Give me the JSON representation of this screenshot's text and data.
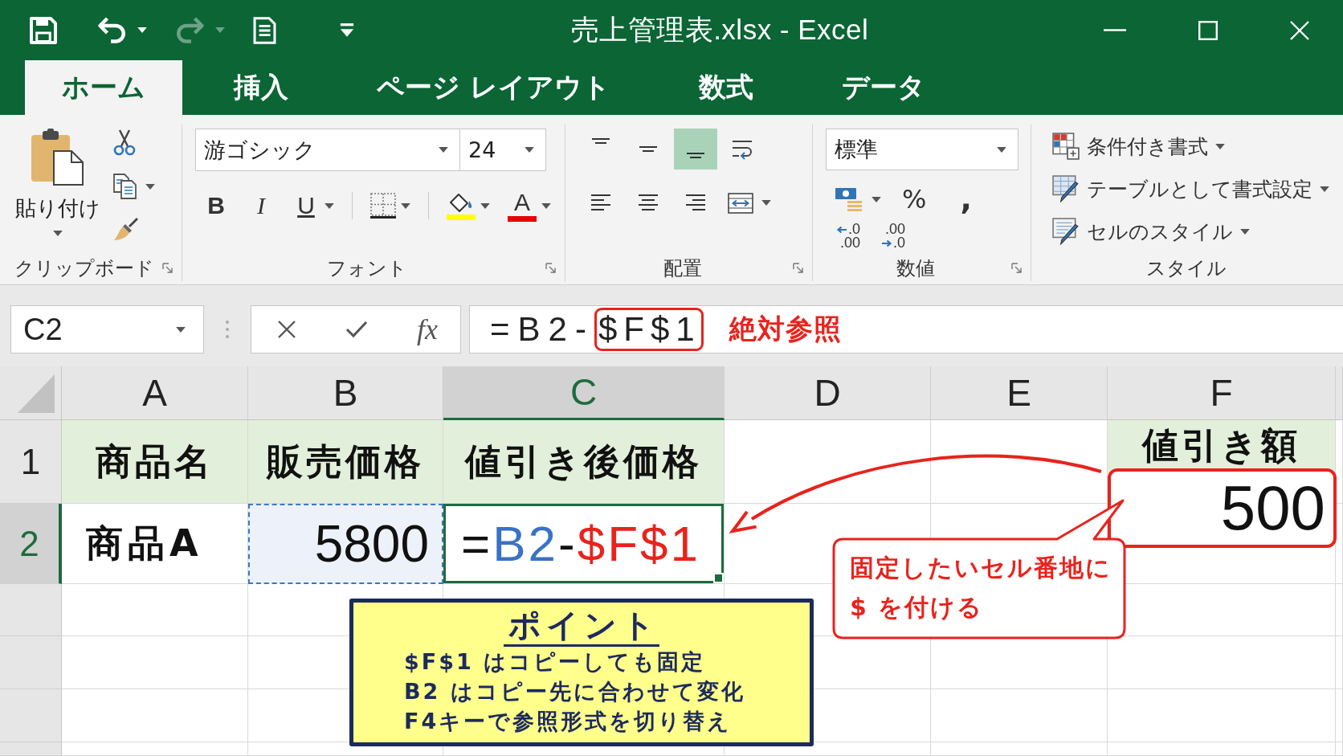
{
  "title_bar": {
    "quick_access": [
      {
        "kind": "save",
        "disabled": false,
        "dropdown": false
      },
      {
        "kind": "undo",
        "disabled": false,
        "dropdown": true
      },
      {
        "kind": "redo",
        "disabled": true,
        "dropdown": true
      },
      {
        "kind": "form",
        "disabled": false,
        "dropdown": false
      },
      {
        "kind": "customize",
        "disabled": false,
        "dropdown": false
      }
    ],
    "title": "売上管理表.xlsx - Excel",
    "window_controls": [
      {
        "kind": "minimize"
      },
      {
        "kind": "maximize"
      },
      {
        "kind": "close"
      }
    ]
  },
  "tabs": [
    {
      "label": "ホーム",
      "selected": true
    },
    {
      "label": "挿入",
      "selected": false
    },
    {
      "label": "ページ レイアウト",
      "selected": false
    },
    {
      "label": "数式",
      "selected": false
    },
    {
      "label": "データ",
      "selected": false
    }
  ],
  "ribbon": [
    {
      "kind": "clipboard",
      "label": "クリップボード",
      "launcher": true,
      "paste": {
        "label": "貼り付け",
        "dropdown": true
      },
      "tools": [
        {
          "kind": "cut",
          "dropdown": false
        },
        {
          "kind": "copy",
          "dropdown": true
        },
        {
          "kind": "format_painter",
          "dropdown": false
        }
      ]
    },
    {
      "kind": "font",
      "label": "フォント",
      "launcher": true,
      "font_name": "游ゴシック",
      "font_size": "24",
      "buttons": [
        {
          "kind": "bold",
          "label": "B",
          "dropdown": false
        },
        {
          "kind": "italic",
          "label": "I",
          "dropdown": false
        },
        {
          "kind": "underline",
          "label": "U",
          "dropdown": true
        },
        {
          "kind": "separator"
        },
        {
          "kind": "borders",
          "dropdown": true
        },
        {
          "kind": "separator"
        },
        {
          "kind": "fill_color",
          "color": "#ffff00",
          "dropdown": true
        },
        {
          "kind": "font_color",
          "label": "A",
          "color": "#e50000",
          "dropdown": true
        }
      ]
    },
    {
      "kind": "alignment",
      "label": "配置",
      "launcher": true,
      "button_rows": [
        [
          {
            "kind": "align_top",
            "selected": false,
            "dropdown": false
          },
          {
            "kind": "align_middle",
            "selected": false,
            "dropdown": false
          },
          {
            "kind": "align_bottom",
            "selected": true,
            "dropdown": false
          },
          {
            "kind": "wrap_text",
            "selected": false,
            "dropdown": false
          }
        ],
        [
          {
            "kind": "align_left",
            "selected": false,
            "dropdown": false
          },
          {
            "kind": "align_center",
            "selected": false,
            "dropdown": false
          },
          {
            "kind": "align_right",
            "selected": false,
            "dropdown": false
          },
          {
            "kind": "merge",
            "selected": false,
            "dropdown": true
          }
        ]
      ]
    },
    {
      "kind": "number",
      "label": "数値",
      "launcher": true,
      "format": "標準",
      "button_rows": [
        [
          {
            "kind": "currency",
            "dropdown": true
          },
          {
            "kind": "percent",
            "label": "%",
            "dropdown": false
          },
          {
            "kind": "comma",
            "label": ",",
            "dropdown": false
          }
        ],
        [
          {
            "kind": "increase_decimal",
            "lines": [
              ".0",
              ".00"
            ]
          },
          {
            "kind": "decrease_decimal",
            "lines": [
              ".00",
              ".0"
            ]
          }
        ]
      ]
    },
    {
      "kind": "styles",
      "label": "スタイル",
      "launcher": false,
      "items": [
        {
          "kind": "conditional_formatting",
          "label": "条件付き書式",
          "dropdown": true
        },
        {
          "kind": "format_as_table",
          "label": "テーブルとして書式設定",
          "dropdown": true
        },
        {
          "kind": "cell_styles",
          "label": "セルのスタイル",
          "dropdown": true
        }
      ]
    }
  ],
  "formula_bar": {
    "name_box": "C2",
    "function_label": "fx",
    "formula": [
      {
        "text": "=B2-",
        "highlighted": false
      },
      {
        "text": "$F$1",
        "highlighted": true
      }
    ],
    "annotation": "絶対参照"
  },
  "sheet": {
    "columns": [
      {
        "label": "A",
        "selected": false
      },
      {
        "label": "B",
        "selected": false
      },
      {
        "label": "C",
        "selected": true
      },
      {
        "label": "D",
        "selected": false
      },
      {
        "label": "E",
        "selected": false
      },
      {
        "label": "F",
        "selected": false
      }
    ],
    "rows": [
      {
        "label": "1",
        "selected": false,
        "cells": [
          {
            "kind": "heading",
            "text": "商品名",
            "selected": false,
            "referenced": false,
            "highlighted": false
          },
          {
            "kind": "heading",
            "text": "販売価格",
            "selected": false,
            "referenced": false,
            "highlighted": false
          },
          {
            "kind": "heading",
            "text": "値引き後価格",
            "selected": false,
            "referenced": false,
            "highlighted": false
          },
          {
            "kind": "empty",
            "selected": false,
            "referenced": false,
            "highlighted": false
          },
          {
            "kind": "empty",
            "selected": false,
            "referenced": false,
            "highlighted": false
          },
          {
            "kind": "heading",
            "text": "値引き額",
            "selected": false,
            "referenced": false,
            "highlighted": false
          }
        ]
      },
      {
        "label": "2",
        "selected": true,
        "cells": [
          {
            "kind": "text",
            "text": "商品A",
            "selected": false,
            "referenced": false,
            "highlighted": false
          },
          {
            "kind": "number",
            "text": "5800",
            "selected": false,
            "referenced": true,
            "highlighted": false
          },
          {
            "kind": "formula",
            "selected": true,
            "referenced": false,
            "highlighted": false,
            "parts": [
              {
                "kind": "operator",
                "text": "="
              },
              {
                "kind": "relative_ref",
                "text": "B2"
              },
              {
                "kind": "operator",
                "text": "-"
              },
              {
                "kind": "absolute_ref",
                "text": "$F$1"
              }
            ]
          },
          {
            "kind": "empty",
            "selected": false,
            "referenced": false,
            "highlighted": false
          },
          {
            "kind": "empty",
            "selected": false,
            "referenced": false,
            "highlighted": false
          },
          {
            "kind": "number",
            "text": "500",
            "selected": false,
            "referenced": false,
            "highlighted": true
          }
        ]
      }
    ]
  },
  "annotations": {
    "callout": {
      "lines": [
        "固定したいセル番地に",
        "$ を付ける"
      ]
    },
    "point_box": {
      "title": "ポイント",
      "lines": [
        "$F$1 はコピーしても固定",
        "B2 はコピー先に合わせて変化",
        "F4キーで参照形式を切り替え"
      ]
    }
  }
}
